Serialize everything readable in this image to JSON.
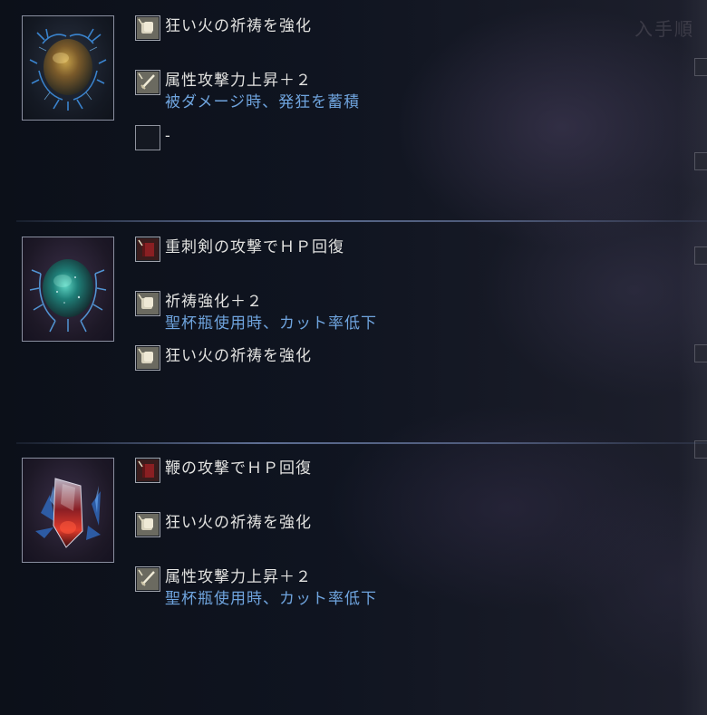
{
  "header": {
    "sort_label_partial": "入手順"
  },
  "colors": {
    "effect_text": "#e2e2e0",
    "condition_text": "#6fa4de",
    "divider": "#7a8cb9"
  },
  "relics": [
    {
      "icon": "blue-gold-relic-icon",
      "effects": [
        {
          "icon": "scroll-icon",
          "text": "狂い火の祈祷を強化",
          "condition": ""
        },
        {
          "icon": "sword-icon",
          "text": "属性攻撃力上昇＋２",
          "condition": "被ダメージ時、発狂を蓄積"
        },
        {
          "icon": "empty-slot-icon",
          "text": "-",
          "condition": ""
        }
      ]
    },
    {
      "icon": "green-teal-relic-icon",
      "effects": [
        {
          "icon": "red-tome-icon",
          "text": "重刺剣の攻撃でＨＰ回復",
          "condition": ""
        },
        {
          "icon": "scroll-icon",
          "text": "祈祷強化＋２",
          "condition": "聖杯瓶使用時、カット率低下"
        },
        {
          "icon": "scroll-icon",
          "text": "狂い火の祈祷を強化",
          "condition": ""
        }
      ]
    },
    {
      "icon": "red-crystal-relic-icon",
      "effects": [
        {
          "icon": "red-tome-icon",
          "text": "鞭の攻撃でＨＰ回復",
          "condition": ""
        },
        {
          "icon": "scroll-icon",
          "text": "狂い火の祈祷を強化",
          "condition": ""
        },
        {
          "icon": "sword-icon",
          "text": "属性攻撃力上昇＋２",
          "condition": "聖杯瓶使用時、カット率低下"
        }
      ]
    }
  ]
}
